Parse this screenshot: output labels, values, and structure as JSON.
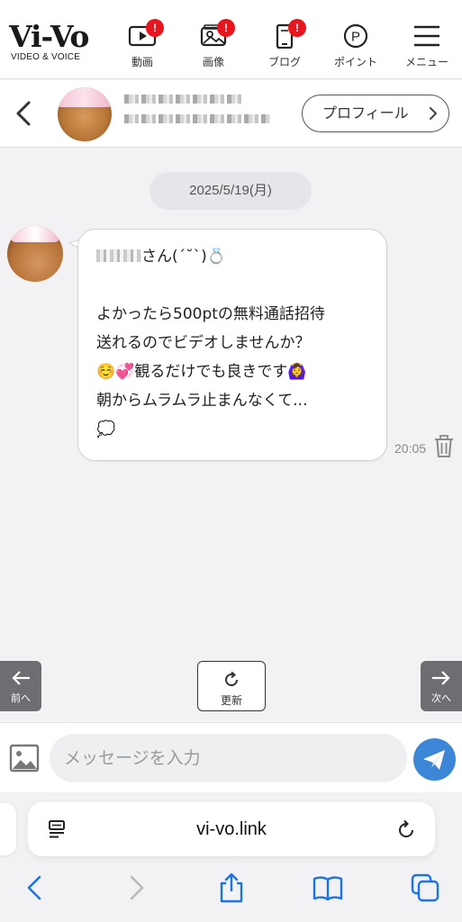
{
  "app": {
    "logo": "Vi-Vo",
    "logo_sub": "VIDEO & VOICE"
  },
  "nav": {
    "items": [
      {
        "label": "動画",
        "icon": "video-play-icon",
        "badge": "!"
      },
      {
        "label": "画像",
        "icon": "image-gallery-icon",
        "badge": "!"
      },
      {
        "label": "ブログ",
        "icon": "blog-phone-icon",
        "badge": "!"
      },
      {
        "label": "ポイント",
        "icon": "point-coin-icon"
      },
      {
        "label": "メニュー",
        "icon": "hamburger-menu-icon"
      }
    ],
    "badge_color": "#e8141e"
  },
  "chat_header": {
    "profile_button": "プロフィール",
    "icons": [
      "chevron-left-icon",
      "chevron-right-icon"
    ]
  },
  "chat": {
    "date": "2025/5/19(月)",
    "message": {
      "line1_suffix": "さん(ˊ˘ˋ)💍",
      "body": "よかったら500ptの無料通話招待\n送れるのでビデオしませんか？\n☺️💞観るだけでも良きです🙆‍♀️\n朝からムラムラ止まんなくて...\n💭",
      "time": "20:05"
    },
    "prev_label": "前へ",
    "next_label": "次へ",
    "refresh_label": "更新",
    "icons": [
      "arrow-left-icon",
      "arrow-right-icon",
      "refresh-icon",
      "trash-icon"
    ]
  },
  "composer": {
    "placeholder": "メッセージを入力",
    "icons": [
      "image-attach-icon",
      "paper-plane-icon"
    ],
    "send_color": "#3b86d6"
  },
  "browser": {
    "url": "vi-vo.link",
    "icons": [
      "reader-mode-icon",
      "reload-icon",
      "back-icon",
      "forward-icon",
      "share-icon",
      "bookmarks-icon",
      "tabs-icon"
    ],
    "accent": "#1a73e8"
  }
}
